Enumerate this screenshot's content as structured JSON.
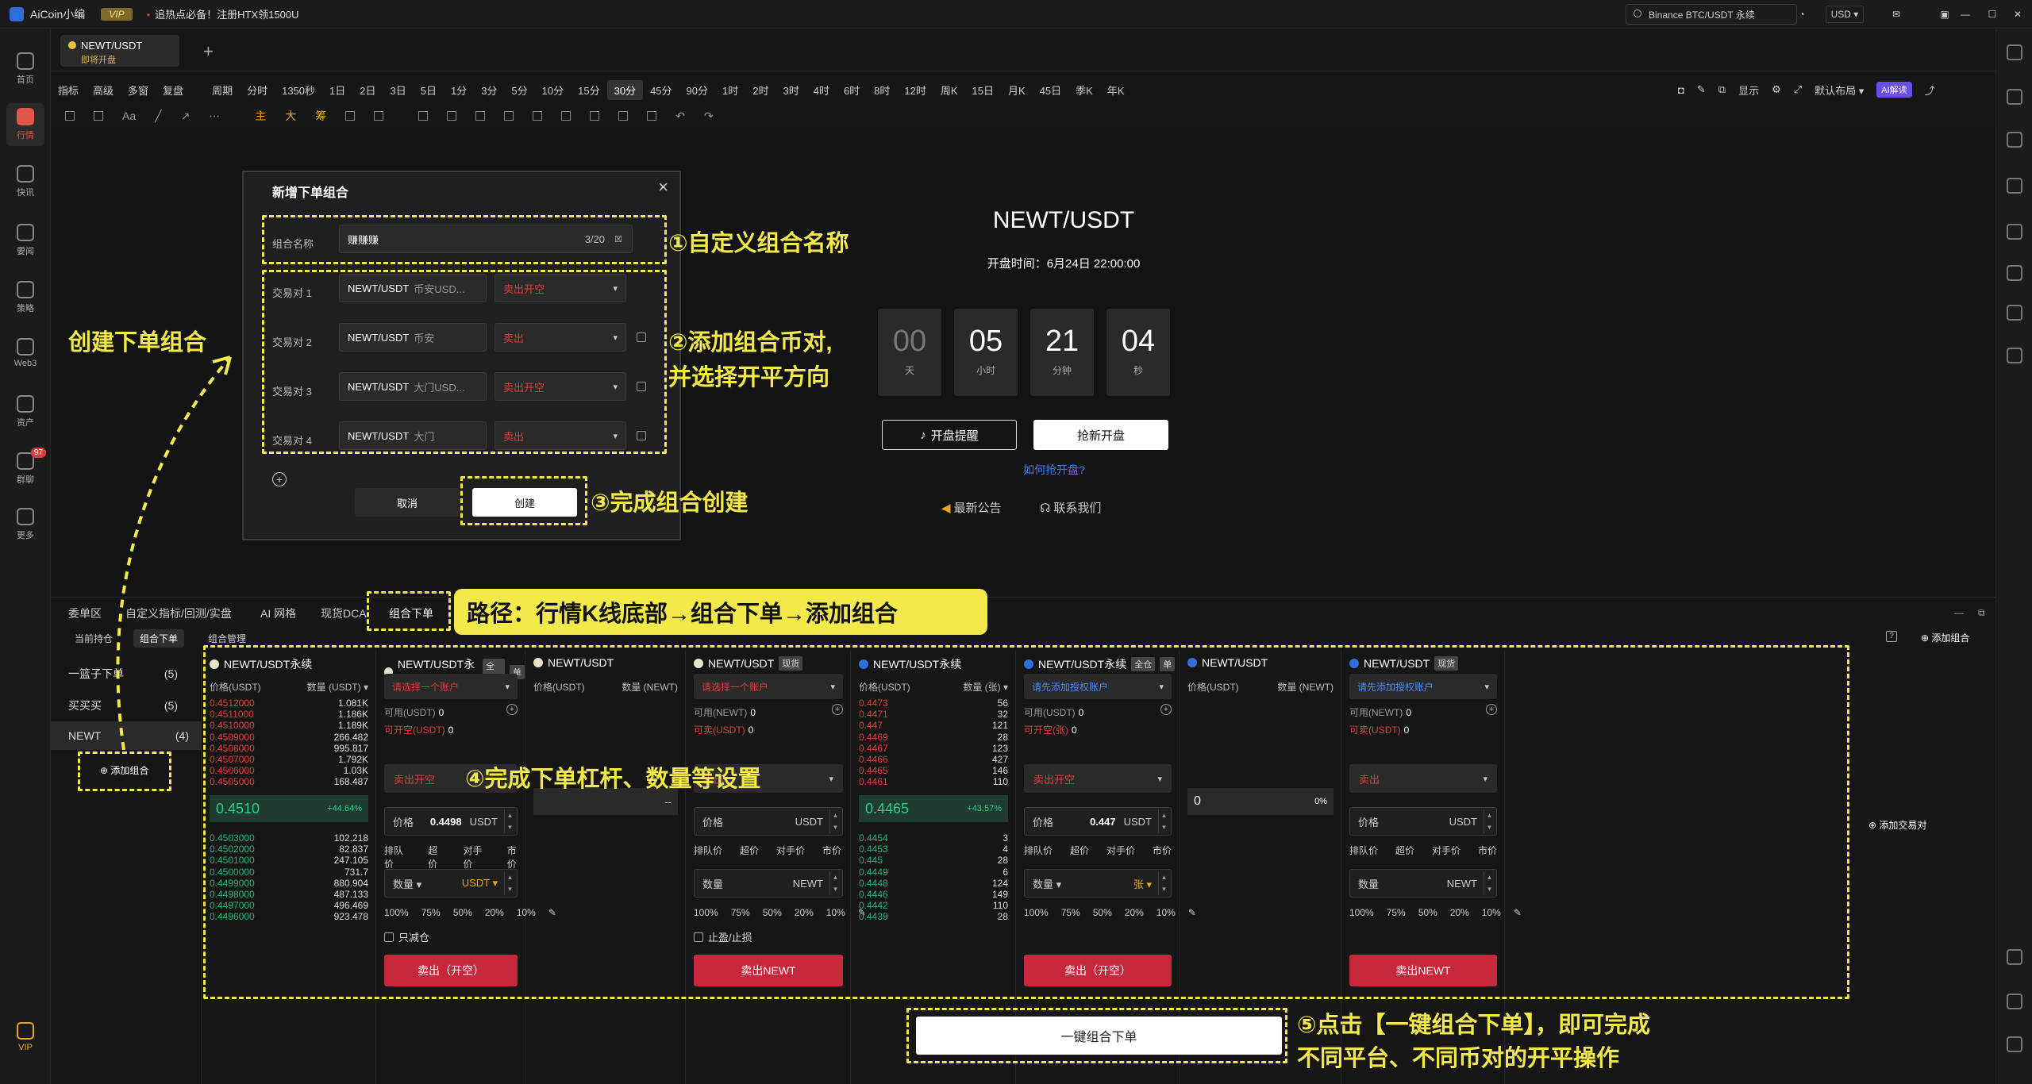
{
  "titlebar": {
    "app_name": "AiCoin小编",
    "vip": "VIP",
    "news": "追热点必备！注册HTX领1500U",
    "search": "Binance BTC/USDT 永续",
    "currency": "USD ▾"
  },
  "sidebar": {
    "items": [
      {
        "label": "首页",
        "icon": "home-icon"
      },
      {
        "label": "行情",
        "icon": "chart-icon"
      },
      {
        "label": "快讯",
        "icon": "news-icon"
      },
      {
        "label": "要闻",
        "icon": "doc-icon"
      },
      {
        "label": "策略",
        "icon": "robot-icon"
      },
      {
        "label": "Web3",
        "icon": "web3-icon"
      },
      {
        "label": "资产",
        "icon": "wallet-icon"
      },
      {
        "label": "群聊",
        "icon": "mail-icon",
        "badge": "97"
      },
      {
        "label": "更多",
        "icon": "grid-icon"
      },
      {
        "label": "VIP",
        "icon": "vip-icon"
      }
    ]
  },
  "tab": {
    "symbol": "NEWT/USDT",
    "status": "即将开盘"
  },
  "periods": [
    "指标",
    "高级",
    "多窗",
    "复盘",
    "",
    "周期",
    "分时",
    "1350秒",
    "1日",
    "2日",
    "3日",
    "5日",
    "1分",
    "3分",
    "5分",
    "10分",
    "15分",
    "30分",
    "45分",
    "90分",
    "1时",
    "2时",
    "3时",
    "4时",
    "6时",
    "8时",
    "12时",
    "周K",
    "15日",
    "月K",
    "45日",
    "季K",
    "年K"
  ],
  "period_selected": "30分",
  "toolbar_right": {
    "display": "显示",
    "layout": "默认布局 ▾",
    "ai": "AI解读"
  },
  "drawtools": {
    "zhu": "主",
    "da": "大",
    "chou": "筹"
  },
  "listing": {
    "title": "NEWT/USDT",
    "open_time": "开盘时间：6月24日 22:00:00",
    "countdown": [
      {
        "value": "00",
        "unit": "天"
      },
      {
        "value": "05",
        "unit": "小时"
      },
      {
        "value": "21",
        "unit": "分钟"
      },
      {
        "value": "04",
        "unit": "秒"
      }
    ],
    "remind_btn": "开盘提醒",
    "grab_btn": "抢新开盘",
    "how_link": "如何抢开盘?",
    "announcement": "最新公告",
    "contact": "联系我们"
  },
  "modal": {
    "title": "新增下单组合",
    "name_label": "组合名称",
    "name_value": "赚赚赚",
    "name_count": "3/20",
    "pairs": [
      {
        "label": "交易对 1",
        "pair": "NEWT/USDT",
        "venue": "币安USD...",
        "side": "卖出开空"
      },
      {
        "label": "交易对 2",
        "pair": "NEWT/USDT",
        "venue": "币安",
        "side": "卖出"
      },
      {
        "label": "交易对 3",
        "pair": "NEWT/USDT",
        "venue": "大门USD...",
        "side": "卖出开空"
      },
      {
        "label": "交易对 4",
        "pair": "NEWT/USDT",
        "venue": "大门",
        "side": "卖出"
      }
    ],
    "cancel": "取消",
    "create": "创建"
  },
  "annotations": {
    "a1": "①自定义组合名称",
    "a2_line1": "②添加组合币对,",
    "a2_line2": "并选择开平方向",
    "a3": "③完成组合创建",
    "a4": "④完成下单杠杆、数量等设置",
    "a5_line1": "⑤点击【一键组合下单】，即可完成",
    "a5_line2": "不同平台、不同币对的开平操作",
    "create_group": "创建下单组合",
    "path": "路径：行情K线底部→组合下单→添加组合"
  },
  "bottom_tabs": [
    "委单区",
    "自定义指标/回测/实盘",
    "AI 网格",
    "现货DCA",
    "组合下单"
  ],
  "sub_tabs": [
    "当前持仓",
    "组合下单",
    "组合管理"
  ],
  "groups": [
    {
      "name": "一篮子下单",
      "count": "(5)"
    },
    {
      "name": "买买买",
      "count": "(5)"
    },
    {
      "name": "NEWT",
      "count": "(4)"
    }
  ],
  "add_group": "添加组合",
  "add_group_top": "添加组合",
  "add_pair": "添加交易对",
  "columns": [
    {
      "title": "NEWT/USDT永续",
      "coin": "light",
      "head_price": "价格(USDT)",
      "head_qty": "数量 (USDT) ▾",
      "asks": [
        [
          "0.4512000",
          "1.081K"
        ],
        [
          "0.4511000",
          "1.186K"
        ],
        [
          "0.4510000",
          "1.189K"
        ],
        [
          "0.4509000",
          "266.482"
        ],
        [
          "0.4508000",
          "995.817"
        ],
        [
          "0.4507000",
          "1.792K"
        ],
        [
          "0.4506000",
          "1.03K"
        ],
        [
          "0.4505000",
          "168.487"
        ]
      ],
      "mid": "0.4510",
      "change": "+44.64%",
      "bids": [
        [
          "0.4503000",
          "102.218"
        ],
        [
          "0.4502000",
          "82.837"
        ],
        [
          "0.4501000",
          "247.105"
        ],
        [
          "0.4500000",
          "731.7"
        ],
        [
          "0.4499000",
          "880.904"
        ],
        [
          "0.4498000",
          "487.133"
        ],
        [
          "0.4497000",
          "496.469"
        ],
        [
          "0.4496000",
          "923.478"
        ]
      ]
    },
    {
      "title": "NEWT/USDT永续",
      "tags": [
        "全仓",
        "单"
      ],
      "coin": "light",
      "account": "请选择一个账户",
      "avail": "可用(USDT)",
      "avail_v": "0",
      "open": "可开空(USDT)",
      "open_v": "0",
      "side": "卖出开空",
      "price_label": "价格",
      "price_value": "0.4498",
      "price_unit": "USDT",
      "opts": [
        "排队价",
        "超价",
        "对手价",
        "市价"
      ],
      "qty_label": "数量 ▾",
      "qty_unit": "USDT ▾",
      "pcts": [
        "100%",
        "75%",
        "50%",
        "20%",
        "10%"
      ],
      "check": "只减仓",
      "btn": "卖出（开空）"
    },
    {
      "title": "NEWT/USDT",
      "coin": "light",
      "head_price": "价格(USDT)",
      "head_qty": "数量 (NEWT)",
      "mid_dash": "--"
    },
    {
      "title": "NEWT/USDT",
      "tags": [
        "现货"
      ],
      "coin": "light",
      "account": "请选择一个账户",
      "avail": "可用(NEWT)",
      "avail_v": "0",
      "open": "可卖(USDT)",
      "open_v": "0",
      "side": "卖出",
      "price_label": "价格",
      "price_value": "",
      "price_unit": "USDT",
      "opts": [
        "排队价",
        "超价",
        "对手价",
        "市价"
      ],
      "qty_label": "数量",
      "qty_unit": "NEWT",
      "pcts": [
        "100%",
        "75%",
        "50%",
        "20%",
        "10%"
      ],
      "check": "止盈/止损",
      "btn": "卖出NEWT"
    },
    {
      "title": "NEWT/USDT永续",
      "coin": "blue",
      "head_price": "价格(USDT)",
      "head_qty": "数量 (张) ▾",
      "asks": [
        [
          "0.4473",
          "56"
        ],
        [
          "0.4471",
          "32"
        ],
        [
          "0.447",
          "121"
        ],
        [
          "0.4469",
          "28"
        ],
        [
          "0.4467",
          "123"
        ],
        [
          "0.4466",
          "427"
        ],
        [
          "0.4465",
          "146"
        ],
        [
          "0.4461",
          "110"
        ]
      ],
      "mid": "0.4465",
      "change": "+43.57%",
      "bids": [
        [
          "0.4454",
          "3"
        ],
        [
          "0.4453",
          "4"
        ],
        [
          "0.445",
          "28"
        ],
        [
          "0.4449",
          "6"
        ],
        [
          "0.4448",
          "124"
        ],
        [
          "0.4446",
          "149"
        ],
        [
          "0.4442",
          "110"
        ],
        [
          "0.4439",
          "28"
        ]
      ]
    },
    {
      "title": "NEWT/USDT永续",
      "tags": [
        "全仓",
        "单"
      ],
      "coin": "blue",
      "account": "请先添加授权账户",
      "avail": "可用(USDT)",
      "avail_v": "0",
      "open": "可开空(张)",
      "open_v": "0",
      "side": "卖出开空",
      "price_label": "价格",
      "price_value": "0.447",
      "price_unit": "USDT",
      "opts": [
        "排队价",
        "超价",
        "对手价",
        "市价"
      ],
      "qty_label": "数量 ▾",
      "qty_unit": "张 ▾",
      "pcts": [
        "100%",
        "75%",
        "50%",
        "20%",
        "10%"
      ],
      "btn": "卖出（开空）"
    },
    {
      "title": "NEWT/USDT",
      "coin": "blue",
      "head_price": "价格(USDT)",
      "head_qty": "数量 (NEWT)",
      "mid_plain": "0",
      "mid_pct": "0%"
    },
    {
      "title": "NEWT/USDT",
      "tags": [
        "现货"
      ],
      "coin": "blue",
      "account": "请先添加授权账户",
      "avail": "可用(NEWT)",
      "avail_v": "0",
      "open": "可卖(USDT)",
      "open_v": "0",
      "side": "卖出",
      "price_label": "价格",
      "price_value": "",
      "price_unit": "USDT",
      "opts": [
        "排队价",
        "超价",
        "对手价",
        "市价"
      ],
      "qty_label": "数量",
      "qty_unit": "NEWT",
      "pcts": [
        "100%",
        "75%",
        "50%",
        "20%",
        "10%"
      ],
      "btn": "卖出NEWT"
    }
  ],
  "onekey": "一键组合下单",
  "colors": {
    "accent": "#f3e94a",
    "sell": "#c5283a",
    "up": "#1fb37a",
    "down": "#e23b3b"
  }
}
